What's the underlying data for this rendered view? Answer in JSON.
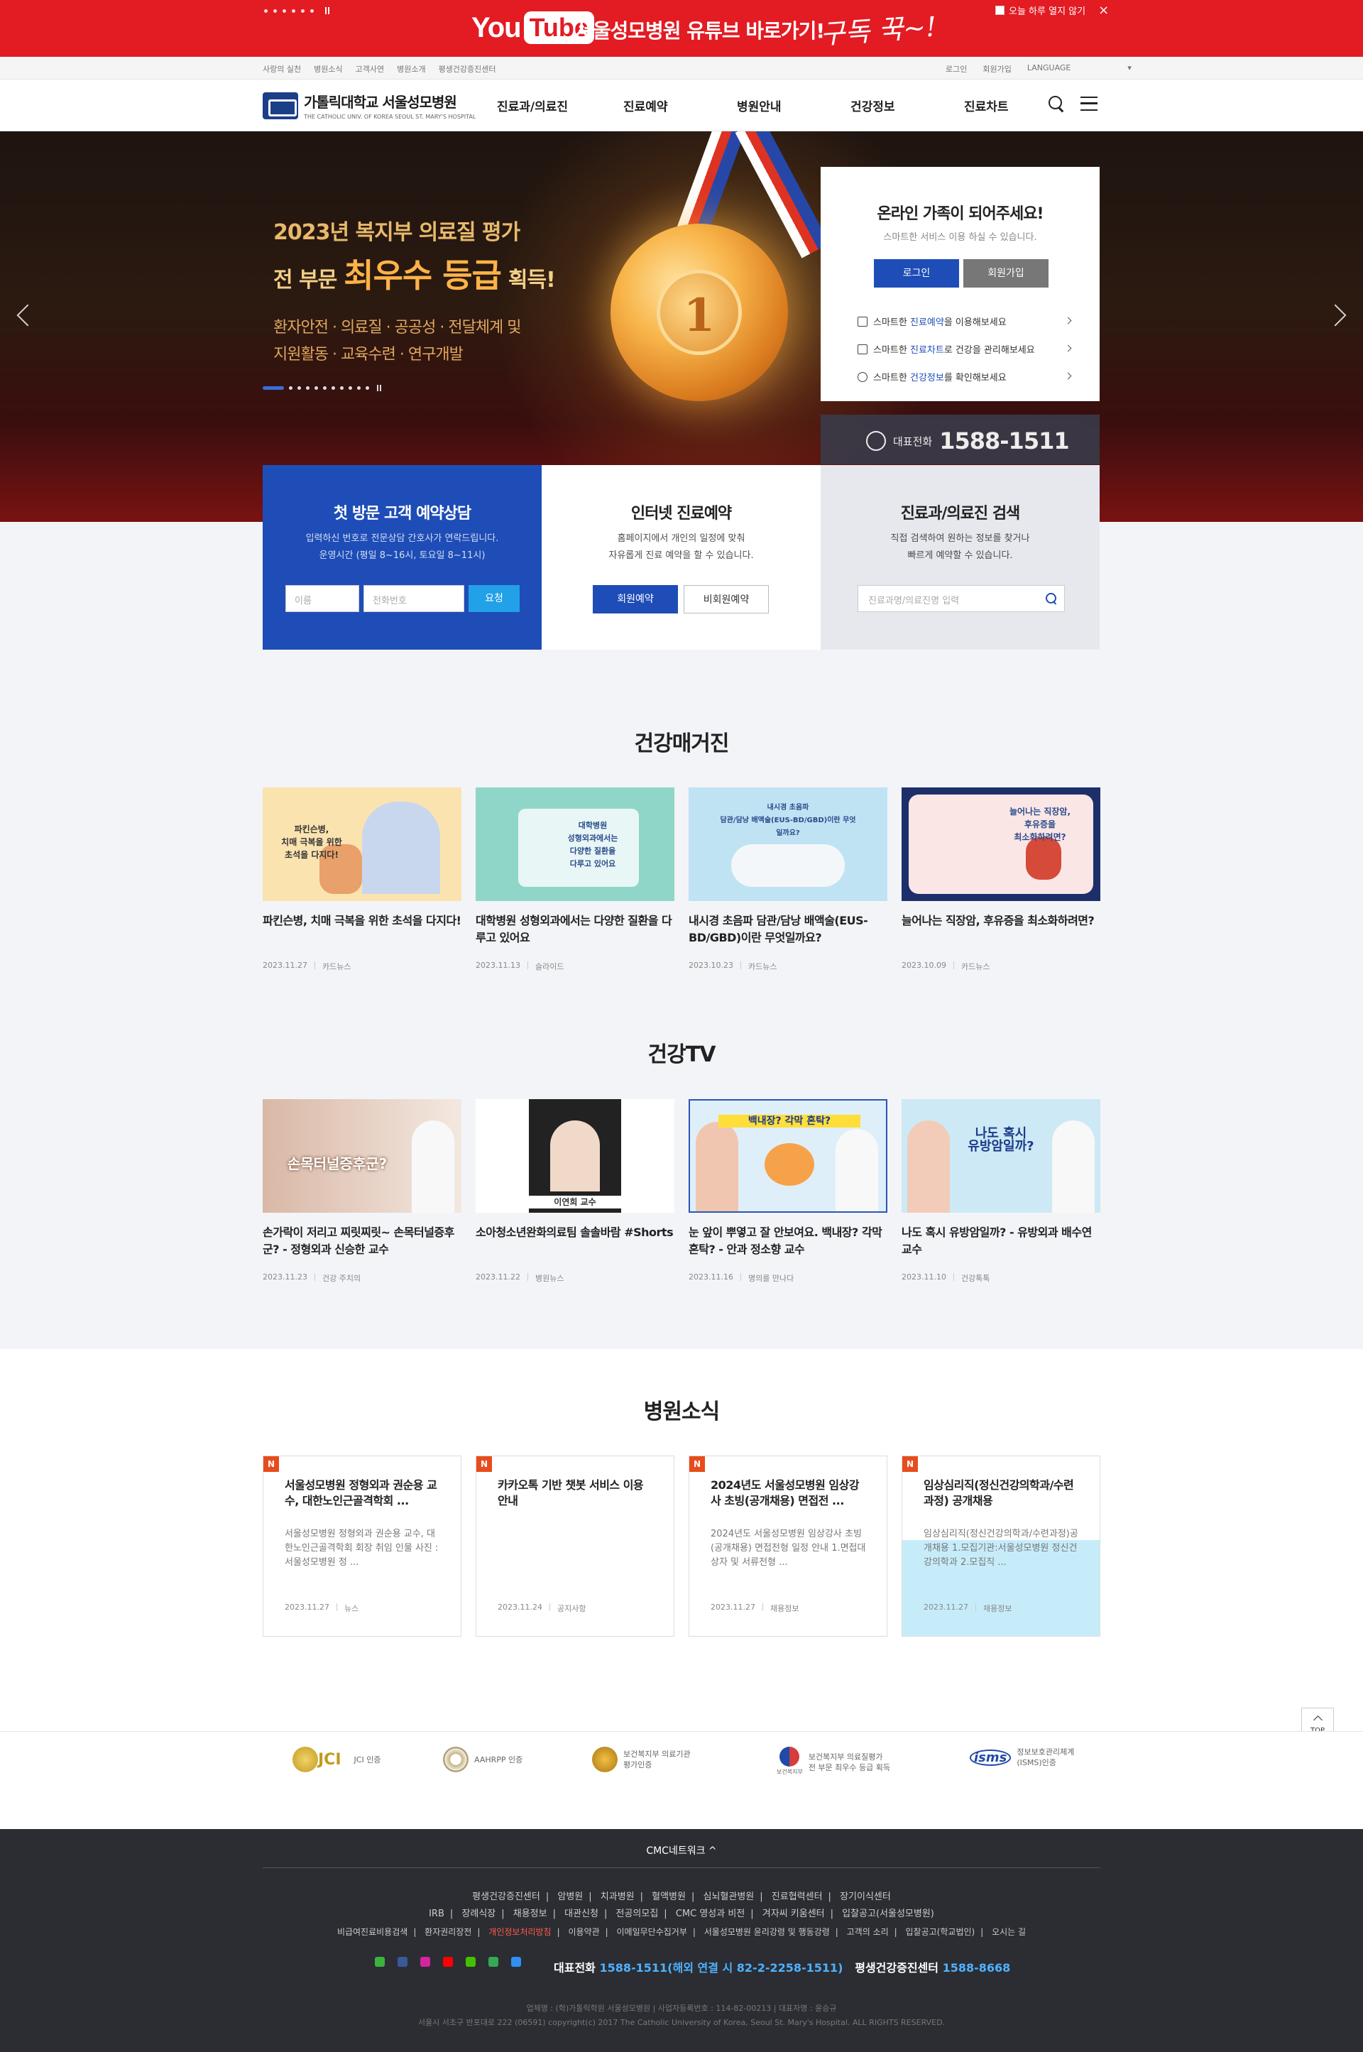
{
  "top_banner": {
    "yt_you": "You",
    "yt_tube": "Tube",
    "text": "서울성모병원 유튜브 바로가기!",
    "subscribe": "구독 꾹~!",
    "today_close": "오늘 하루 열지 않기",
    "close": "×",
    "bg_color": "#e31b23"
  },
  "util_nav": {
    "left": [
      "사랑의 실천",
      "병원소식",
      "고객사연",
      "병원소개",
      "평생건강증진센터"
    ],
    "right": [
      "로그인",
      "회원가입",
      "LANGUAGE"
    ]
  },
  "header": {
    "logo_title": "가톨릭대학교 서울성모병원",
    "logo_sub": "THE CATHOLIC UNIV. OF KOREA SEOUL ST. MARY'S HOSPITAL",
    "nav": [
      "진료과/의료진",
      "진료예약",
      "병원안내",
      "건강정보",
      "진료차트"
    ]
  },
  "hero": {
    "line1": "2023년 복지부 의료질 평가",
    "line2_pre": "전 부문",
    "line2_big": "최우수 등급",
    "line2_post": "획득!",
    "line3a": "환자안전 · 의료질 · 공공성 · 전달체계 및",
    "line3b": "지원활동 · 교육수련 · 연구개발",
    "medal_num": "1"
  },
  "login_box": {
    "title": "온라인 가족이 되어주세요!",
    "sub": "스마트한 서비스 이용 하실 수 있습니다.",
    "login": "로그인",
    "join": "회원가입",
    "links": [
      {
        "pre": "스마트한 ",
        "em": "진료예약",
        "post": "을 이용해보세요"
      },
      {
        "pre": "스마트한 ",
        "em": "진료차트",
        "post": "로 건강을 관리해보세요"
      },
      {
        "pre": "스마트한 ",
        "em": "건강정보",
        "post": "를 확인해보세요"
      }
    ],
    "phone_label": "대표전화",
    "phone": "1588-1511"
  },
  "quick": {
    "p1": {
      "title": "첫 방문 고객 예약상담",
      "desc1": "입력하신 번호로 전문상담 간호사가 연락드립니다.",
      "desc2": "운영시간 (평일 8~16시, 토요일 8~11시)",
      "name_ph": "이름",
      "tel_ph": "전화번호",
      "btn": "요청"
    },
    "p2": {
      "title": "인터넷 진료예약",
      "desc1": "홈페이지에서 개인의 일정에 맞춰",
      "desc2": "자유롭게 진료 예약을 할 수 있습니다.",
      "btn_member": "회원예약",
      "btn_nonmember": "비회원예약"
    },
    "p3": {
      "title": "진료과/의료진 검색",
      "desc1": "직접 검색하여 원하는 정보를 찾거나",
      "desc2": "빠르게 예약할 수 있습니다.",
      "search_ph": "진료과명/의료진명 입력"
    }
  },
  "magazine": {
    "title": "건강매거진",
    "items": [
      {
        "title": "파킨슨병, 치매 극복을 위한 초석을 다지다!",
        "date": "2023.11.27",
        "cat": "카드뉴스",
        "thumb_text": "파킨슨병,\n치매 극복을 위한\n초석을 다지다!"
      },
      {
        "title": "대학병원 성형외과에서는 다양한 질환을 다루고 있어요",
        "date": "2023.11.13",
        "cat": "슬라이드",
        "thumb_text": "대학병원\n성형외과에서는\n다양한 질환을\n다루고 있어요"
      },
      {
        "title": "내시경 초음파 담관/담낭 배액술(EUS-BD/GBD)이란 무엇일까요?",
        "date": "2023.10.23",
        "cat": "카드뉴스",
        "thumb_text": "내시경 초음파\n담관/담낭 배액술(EUS-BD/GBD)이란 무엇일까요?"
      },
      {
        "title": "늘어나는 직장암, 후유증을 최소화하려면?",
        "date": "2023.10.09",
        "cat": "카드뉴스",
        "thumb_text": "늘어나는 직장암,\n후유증을\n최소화하려면?"
      }
    ]
  },
  "tv": {
    "title": "건강TV",
    "items": [
      {
        "title": "손가락이 저리고 찌릿찌릿~ 손목터널증후군? - 정형외과 신승한 교수",
        "date": "2023.11.23",
        "cat": "건강 주치의",
        "thumb_text": "손목터널증후군?"
      },
      {
        "title": "소아청소년완화의료팀 솔솔바람 #Shorts",
        "date": "2023.11.22",
        "cat": "병원뉴스",
        "thumb_text": "이연희 교수"
      },
      {
        "title": "눈 앞이 뿌옇고 잘 안보여요. 백내장? 각막 혼탁? - 안과 정소향 교수",
        "date": "2023.11.16",
        "cat": "명의를 만나다",
        "thumb_text": "백내장? 각막 혼탁?"
      },
      {
        "title": "나도 혹시 유방암일까? - 유방외과 배수연 교수",
        "date": "2023.11.10",
        "cat": "건강톡톡",
        "thumb_text": "나도 혹시\n유방암일까?"
      }
    ]
  },
  "news": {
    "title": "병원소식",
    "badge": "N",
    "items": [
      {
        "title": "서울성모병원 정형외과 권순용 교수, 대한노인근골격학회 ...",
        "desc": "서울성모병원 정형외과 권순용 교수, 대한노인근골격학회 회장 취임 인물 사진 : 서울성모병원 정 ...",
        "date": "2023.11.27",
        "cat": "뉴스"
      },
      {
        "title": "카카오톡 기반 챗봇 서비스 이용 안내",
        "desc": "",
        "date": "2023.11.24",
        "cat": "공지사항"
      },
      {
        "title": "2024년도 서울성모병원 임상강사 초빙(공개채용) 면접전 ...",
        "desc": "2024년도 서울성모병원 임상강사 초빙(공개채용) 면접전형 일정 안내 1.면접대상자 및 서류전형 ...",
        "date": "2023.11.27",
        "cat": "채용정보"
      },
      {
        "title": "임상심리직(정신건강의학과/수련과정) 공개채용",
        "desc": "임상심리직(정신건강의학과/수련과정)공개채용 1.모집기관:서울성모병원 정신건강의학과 2.모집직 ...",
        "date": "2023.11.27",
        "cat": "채용정보"
      }
    ]
  },
  "top_button": "TOP",
  "certs": [
    {
      "name": "JCI 인증",
      "logo": "JCI"
    },
    {
      "name": "AAHRPP 인증",
      "logo": ""
    },
    {
      "name": "보건복지부 의료기관\n평가인증",
      "logo": ""
    },
    {
      "name": "보건복지부 의료질평가\n전 부문 최우수 등급 획득",
      "logo": "보건복지부"
    },
    {
      "name": "정보보호관리체계\n(ISMS)인증",
      "logo": "isms"
    }
  ],
  "footer": {
    "cmc": "CMC네트워크 ^",
    "row1": [
      "평생건강증진센터",
      "암병원",
      "치과병원",
      "혈액병원",
      "심뇌혈관병원",
      "진료협력센터",
      "장기이식센터"
    ],
    "row2": [
      "IRB",
      "장례식장",
      "채용정보",
      "대관신청",
      "전공의모집",
      "CMC 영성과 비전",
      "겨자씨 키움센터",
      "입찰공고(서울성모병원)"
    ],
    "row3": [
      "비급여진료비용검색",
      "환자권리장전",
      "개인정보처리방침",
      "이용약관",
      "이메일무단수집거부",
      "서울성모병원 윤리강령 및 행동강령",
      "고객의 소리",
      "입찰공고(학교법인)",
      "오시는 길"
    ],
    "row3_highlight": "개인정보처리방침",
    "sns": [
      "blog",
      "facebook",
      "instagram",
      "youtube",
      "post",
      "playstore",
      "appstore"
    ],
    "tel_label": "대표전화",
    "tel": "1588-1511(해외 연결 시 82-2-2258-1511)",
    "center_label": "평생건강증진센터",
    "center_tel": "1588-8668",
    "addr1": "업체명 : (학)가톨릭학원 서울성모병원 | 사업자등록번호 : 114-82-00213 | 대표자명 : 윤승규",
    "addr2": "서울시 서초구 반포대로 222 (06591) copyright(c) 2017 The Catholic University of Korea, Seoul St. Mary's Hospital. ALL RIGHTS RESERVED."
  }
}
